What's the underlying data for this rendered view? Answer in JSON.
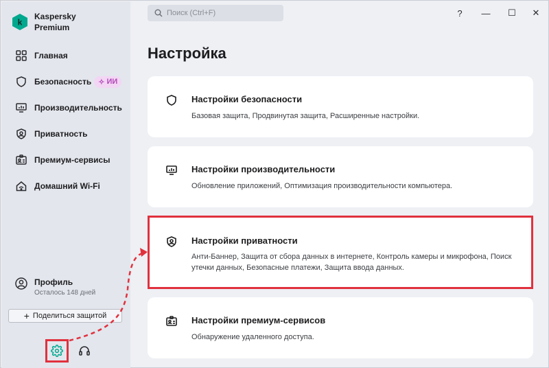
{
  "app": {
    "brand_line1": "Kaspersky",
    "brand_line2": "Premium",
    "accent_color": "#00a88e",
    "highlight_color": "#e0313d"
  },
  "sidebar": {
    "items": [
      {
        "label": "Главная",
        "icon": "dashboard-icon"
      },
      {
        "label": "Безопасность",
        "icon": "shield-icon",
        "badge": "ИИ"
      },
      {
        "label": "Производительность",
        "icon": "monitor-icon"
      },
      {
        "label": "Приватность",
        "icon": "privacy-icon"
      },
      {
        "label": "Премиум-сервисы",
        "icon": "id-card-icon"
      },
      {
        "label": "Домашний Wi-Fi",
        "icon": "home-wifi-icon"
      }
    ],
    "profile": {
      "title": "Профиль",
      "subtitle": "Осталось 148 дней"
    },
    "share_button": "Поделиться защитой"
  },
  "topbar": {
    "search_placeholder": "Поиск (Ctrl+F)",
    "help": "?",
    "minimize": "—",
    "maximize": "☐",
    "close": "✕"
  },
  "main": {
    "title": "Настройка",
    "cards": [
      {
        "title": "Настройки безопасности",
        "description": "Базовая защита, Продвинутая защита, Расширенные настройки.",
        "icon": "shield-icon"
      },
      {
        "title": "Настройки производительности",
        "description": "Обновление приложений, Оптимизация производительности компьютера.",
        "icon": "monitor-icon"
      },
      {
        "title": "Настройки приватности",
        "description": "Анти-Баннер, Защита от сбора данных в интернете, Контроль камеры и микрофона, Поиск утечки данных, Безопасные платежи, Защита ввода данных.",
        "icon": "privacy-icon"
      },
      {
        "title": "Настройки премиум-сервисов",
        "description": "Обнаружение удаленного доступа.",
        "icon": "id-card-icon"
      }
    ]
  }
}
